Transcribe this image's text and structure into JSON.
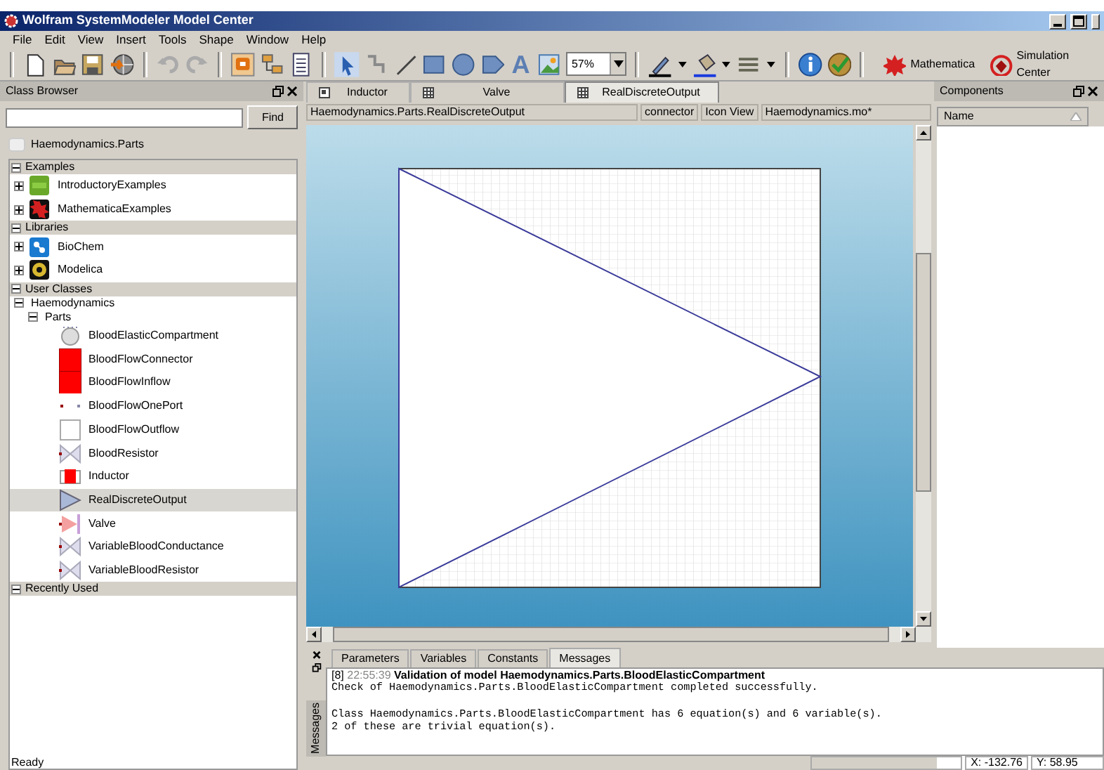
{
  "window": {
    "title": "Wolfram SystemModeler Model Center"
  },
  "menu": [
    "File",
    "Edit",
    "View",
    "Insert",
    "Tools",
    "Shape",
    "Window",
    "Help"
  ],
  "toolbar": {
    "text_tool": "A",
    "zoom": "57%",
    "apps": [
      {
        "label": "Mathematica",
        "kind": "star"
      },
      {
        "label": "Simulation Center",
        "kind": "sim"
      }
    ]
  },
  "class_browser": {
    "title": "Class Browser",
    "find_button": "Find",
    "path": "Haemodynamics.Parts",
    "sections": [
      {
        "label": "Examples",
        "expanded": true,
        "children": [
          {
            "label": "IntroductoryExamples",
            "kind": "intro",
            "expanded": false
          },
          {
            "label": "MathematicaExamples",
            "kind": "mathematica",
            "expanded": false
          }
        ]
      },
      {
        "label": "Libraries",
        "expanded": true,
        "children": [
          {
            "label": "BioChem",
            "kind": "biochem",
            "expanded": false
          },
          {
            "label": "Modelica",
            "kind": "modelica",
            "expanded": false
          }
        ]
      },
      {
        "label": "User Classes",
        "expanded": true,
        "children": [
          {
            "label": "Haemodynamics",
            "expanded": true,
            "children": [
              {
                "label": "Parts",
                "expanded": true,
                "children": [
                  {
                    "label": "BloodElasticCompartment",
                    "kind": "compartment",
                    "selected": false
                  },
                  {
                    "label": "BloodFlowConnector",
                    "kind": "connector",
                    "selected": false
                  },
                  {
                    "label": "BloodFlowInflow",
                    "kind": "connector",
                    "selected": false
                  },
                  {
                    "label": "BloodFlowOnePort",
                    "kind": "oneport",
                    "selected": false
                  },
                  {
                    "label": "BloodFlowOutflow",
                    "kind": "outflow",
                    "selected": false
                  },
                  {
                    "label": "BloodResistor",
                    "kind": "resistor",
                    "selected": false
                  },
                  {
                    "label": "Inductor",
                    "kind": "inductor",
                    "selected": false
                  },
                  {
                    "label": "RealDiscreteOutput",
                    "kind": "output",
                    "selected": true
                  },
                  {
                    "label": "Valve",
                    "kind": "valve",
                    "selected": false
                  },
                  {
                    "label": "VariableBloodConductance",
                    "kind": "resistor",
                    "selected": false
                  },
                  {
                    "label": "VariableBloodResistor",
                    "kind": "resistor",
                    "selected": false
                  }
                ]
              }
            ]
          }
        ]
      },
      {
        "label": "Recently Used",
        "expanded": true
      }
    ]
  },
  "editor": {
    "tabs": [
      {
        "label": "Inductor",
        "kind": "icon",
        "selected": false
      },
      {
        "label": "Valve",
        "kind": "grid",
        "selected": false
      },
      {
        "label": "RealDiscreteOutput",
        "kind": "grid",
        "selected": true
      }
    ],
    "info": [
      "Haemodynamics.Parts.RealDiscreteOutput",
      "connector",
      "Icon View",
      "Haemodynamics.mo*"
    ]
  },
  "components": {
    "title": "Components",
    "column": "Name"
  },
  "messages": {
    "side_label": "Messages",
    "tabs": [
      {
        "label": "Parameters",
        "selected": false
      },
      {
        "label": "Variables",
        "selected": false
      },
      {
        "label": "Constants",
        "selected": false
      },
      {
        "label": "Messages",
        "selected": true
      }
    ],
    "header": {
      "index": "[8]",
      "time": "22:55:39",
      "title": "Validation of model Haemodynamics.Parts.BloodElasticCompartment"
    },
    "paragraphs": [
      [
        "Check of Haemodynamics.Parts.BloodElasticCompartment completed successfully."
      ],
      [
        "Class Haemodynamics.Parts.BloodElasticCompartment has 6 equation(s) and 6 variable(s).",
        "2 of these are trivial equation(s)."
      ]
    ]
  },
  "status_bar": {
    "text": "Ready",
    "x": "X: -132.76",
    "y": "Y: 58.95"
  }
}
